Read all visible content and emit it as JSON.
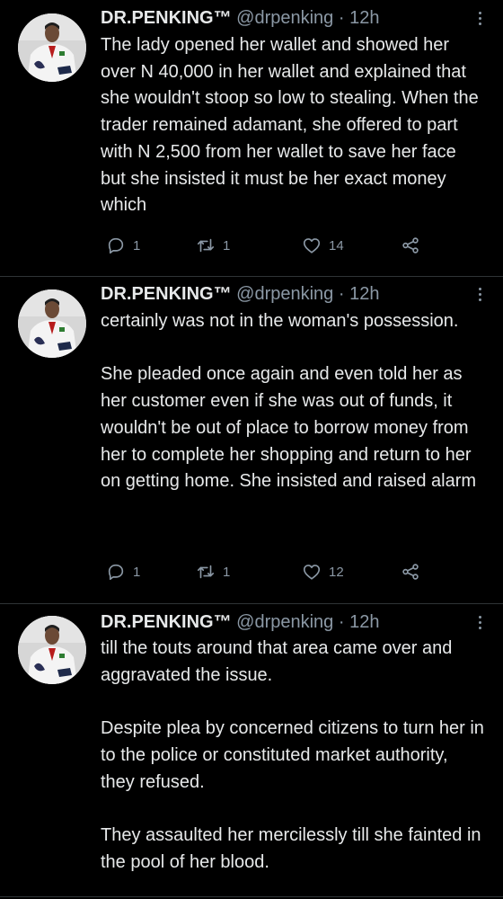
{
  "tweets": [
    {
      "name": "DR.PENKING™",
      "handle": "@drpenking",
      "separator": "·",
      "time": "12h",
      "paragraphs": [
        "The lady opened her wallet and showed her over N 40,000 in her wallet and explained that she wouldn't stoop so low to stealing. When the trader remained adamant, she offered to part with N 2,500 from her wallet to save her face but she insisted it must be her exact money which"
      ],
      "replies": "1",
      "retweets": "1",
      "likes": "14"
    },
    {
      "name": "DR.PENKING™",
      "handle": "@drpenking",
      "separator": "·",
      "time": "12h",
      "paragraphs": [
        "certainly was not in the woman's possession.",
        "She pleaded once again and even told her as her customer even if she was out of funds, it wouldn't be out of place to borrow money from her to complete her shopping and return to her on getting home. She insisted and raised alarm"
      ],
      "replies": "1",
      "retweets": "1",
      "likes": "12"
    },
    {
      "name": "DR.PENKING™",
      "handle": "@drpenking",
      "separator": "·",
      "time": "12h",
      "paragraphs": [
        "till the touts around that area came over and aggravated the issue.",
        "Despite plea by concerned citizens to turn her in to the police or constituted market authority, they refused.",
        "They assaulted her mercilessly till she fainted in the pool of her blood."
      ]
    }
  ],
  "colors": {
    "background": "#000000",
    "text": "#e7e9ea",
    "secondary": "#8b98a5",
    "divider": "#2f3336"
  },
  "icons": {
    "reply": "reply-icon",
    "retweet": "retweet-icon",
    "like": "heart-icon",
    "share": "share-icon",
    "more": "more-options-icon"
  }
}
